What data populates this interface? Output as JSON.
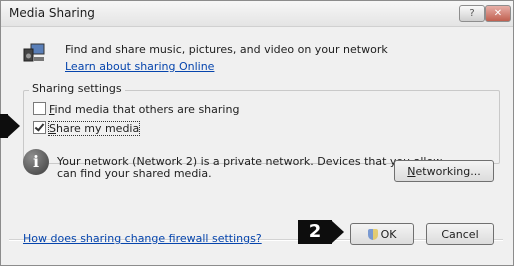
{
  "window": {
    "title": "Media Sharing",
    "help_glyph": "?",
    "close_glyph": "✕"
  },
  "header": {
    "description": "Find and share music, pictures, and video on your network",
    "learn_link": "Learn about sharing Online"
  },
  "sharing_settings": {
    "group_label": "Sharing settings",
    "options": [
      {
        "label": "Find media that others are sharing",
        "mnemonic": "F",
        "rest": "ind media that others are sharing",
        "checked": false
      },
      {
        "label": "Share my media",
        "mnemonic": "S",
        "rest": "hare my media",
        "checked": true
      }
    ]
  },
  "network": {
    "info_icon": "i",
    "line1": "Your network (Network  2) is a private network. Devices that you allow",
    "line2": "can find your shared media.",
    "networking_button": {
      "mnemonic": "N",
      "rest": "etworking..."
    }
  },
  "footer": {
    "firewall_link": "How does sharing change firewall settings?",
    "ok_label": "OK",
    "cancel_label": "Cancel"
  },
  "annotations": {
    "marker_2": "2"
  }
}
